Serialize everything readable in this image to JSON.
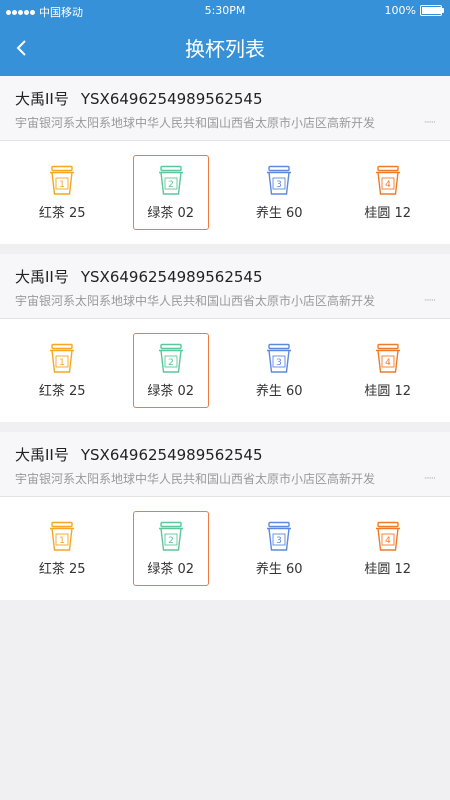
{
  "status": {
    "carrier": "中国移动",
    "time": "5:30PM",
    "battery": "100%",
    "battery_level": 1.0
  },
  "header": {
    "title": "换杯列表"
  },
  "colors": {
    "primary": "#3691d8",
    "selected_border": "#f07a44",
    "cup1": "#f5a623",
    "cup2": "#5cc69c",
    "cup3": "#5b8ae0",
    "cup4": "#ef7b2a"
  },
  "stores": [
    {
      "name": "大禹II号",
      "code": "YSX6496254989562545",
      "address": "宇宙银河系太阳系地球中华人民共和国山西省太原市小店区高新开发",
      "more": "······",
      "cups": [
        {
          "num": "1",
          "label": "红茶 25",
          "icon": "cup-icon-orange",
          "selected": false
        },
        {
          "num": "2",
          "label": "绿茶 02",
          "icon": "cup-icon-green",
          "selected": true
        },
        {
          "num": "3",
          "label": "养生 60",
          "icon": "cup-icon-blue",
          "selected": false
        },
        {
          "num": "4",
          "label": "桂圆 12",
          "icon": "cup-icon-dark-orange",
          "selected": false
        }
      ]
    },
    {
      "name": "大禹II号",
      "code": "YSX6496254989562545",
      "address": "宇宙银河系太阳系地球中华人民共和国山西省太原市小店区高新开发",
      "more": "······",
      "cups": [
        {
          "num": "1",
          "label": "红茶 25",
          "icon": "cup-icon-orange",
          "selected": false
        },
        {
          "num": "2",
          "label": "绿茶 02",
          "icon": "cup-icon-green",
          "selected": true
        },
        {
          "num": "3",
          "label": "养生 60",
          "icon": "cup-icon-blue",
          "selected": false
        },
        {
          "num": "4",
          "label": "桂圆 12",
          "icon": "cup-icon-dark-orange",
          "selected": false
        }
      ]
    },
    {
      "name": "大禹II号",
      "code": "YSX6496254989562545",
      "address": "宇宙银河系太阳系地球中华人民共和国山西省太原市小店区高新开发",
      "more": "······",
      "cups": [
        {
          "num": "1",
          "label": "红茶 25",
          "icon": "cup-icon-orange",
          "selected": false
        },
        {
          "num": "2",
          "label": "绿茶 02",
          "icon": "cup-icon-green",
          "selected": true
        },
        {
          "num": "3",
          "label": "养生 60",
          "icon": "cup-icon-blue",
          "selected": false
        },
        {
          "num": "4",
          "label": "桂圆 12",
          "icon": "cup-icon-dark-orange",
          "selected": false
        }
      ]
    }
  ]
}
